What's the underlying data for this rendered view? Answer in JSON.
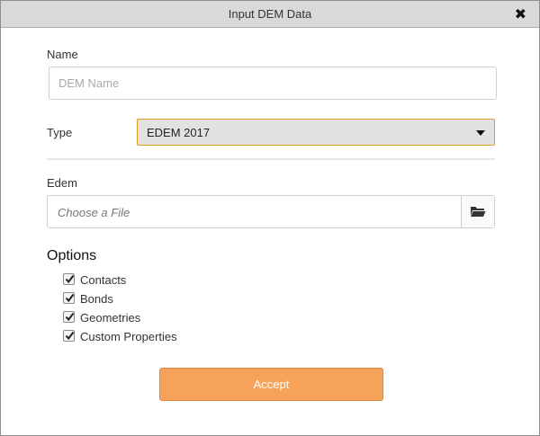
{
  "dialog": {
    "title": "Input DEM Data",
    "close_symbol": "✖"
  },
  "name_field": {
    "label": "Name",
    "placeholder": "DEM Name",
    "value": ""
  },
  "type_field": {
    "label": "Type",
    "selected": "EDEM 2017"
  },
  "edem_field": {
    "label": "Edem",
    "placeholder": "Choose a File",
    "button_icon": "folder-open-icon"
  },
  "options": {
    "title": "Options",
    "items": [
      {
        "label": "Contacts",
        "checked": true
      },
      {
        "label": "Bonds",
        "checked": true
      },
      {
        "label": "Geometries",
        "checked": true
      },
      {
        "label": "Custom Properties",
        "checked": true
      }
    ]
  },
  "accept_button": {
    "label": "Accept"
  },
  "colors": {
    "titlebar": "#d9d9d9",
    "select_border": "#e0a020",
    "accept_bg": "#f7a25a"
  }
}
